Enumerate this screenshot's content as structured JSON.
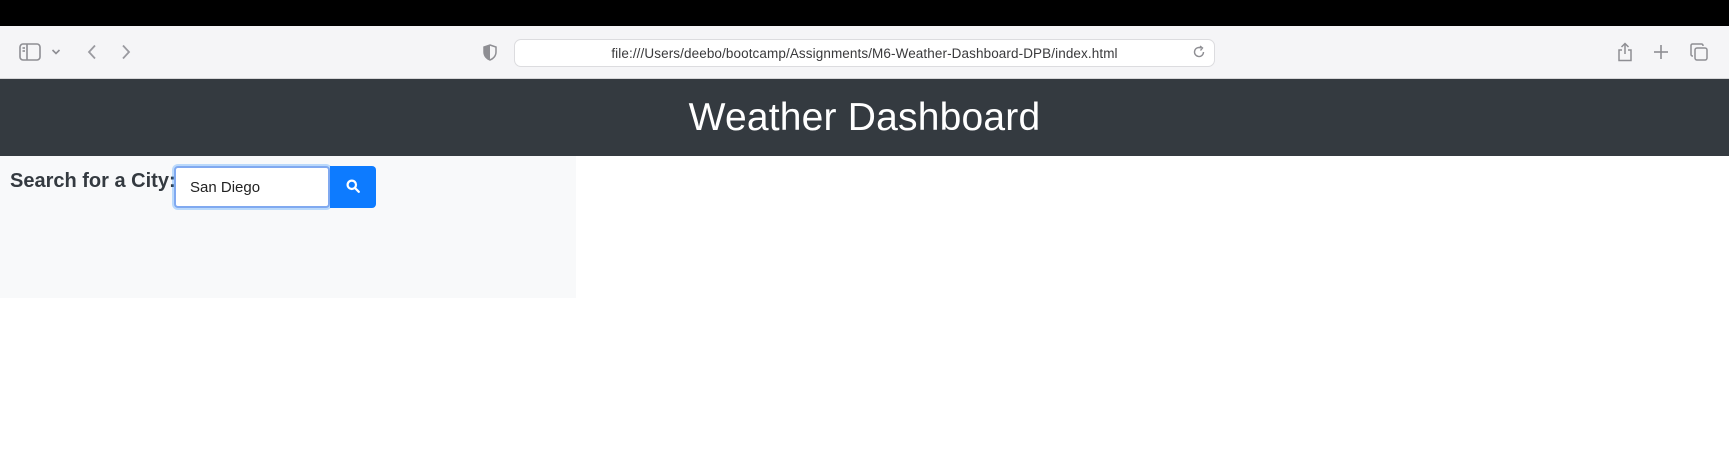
{
  "browser": {
    "url": "file:///Users/deebo/bootcamp/Assignments/M6-Weather-Dashboard-DPB/index.html",
    "icons": {
      "sidebar": "sidebar-toggle-icon",
      "chevron": "chevron-down-icon",
      "back": "back-arrow-icon",
      "forward": "forward-arrow-icon",
      "shield": "privacy-shield-icon",
      "reload": "reload-icon",
      "share": "share-icon",
      "new_tab": "plus-icon",
      "tabs": "tab-overview-icon"
    }
  },
  "header": {
    "title": "Weather Dashboard",
    "background": "#343a40"
  },
  "search": {
    "label": "Search for a City:",
    "value": "San Diego",
    "button_icon": "search-icon",
    "button_color": "#0d7bff"
  }
}
